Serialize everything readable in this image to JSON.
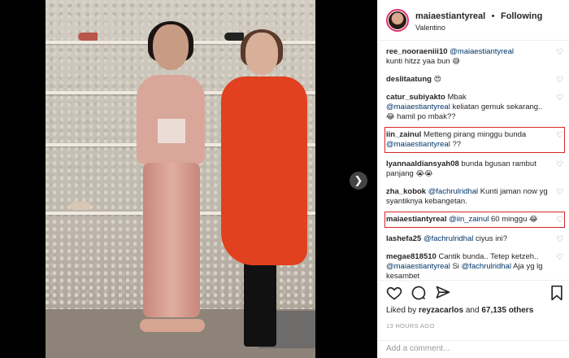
{
  "header": {
    "username": "maiaestiantyreal",
    "separator": "•",
    "follow_status": "Following",
    "location": "Valentino"
  },
  "comments": [
    {
      "user": "ree_nooraeniii10",
      "mention": "@maiaestiantyreal",
      "text": "kunti hitzz yaa bun",
      "emoji": "😅",
      "highlighted": false
    },
    {
      "user": "deslitaatung",
      "mention": "",
      "text": "",
      "emoji": "😍",
      "highlighted": false
    },
    {
      "user": "catur_subiyakto",
      "mention": "",
      "text": "Mbak",
      "mention2": "@maiaestiantyreal",
      "text2": "keliatan gemuk sekarang..",
      "emoji": "😂",
      "text3": "hamil po mbak??",
      "highlighted": false
    },
    {
      "user": "iin_zainul",
      "mention": "",
      "text": "Metteng pirang minggu bunda",
      "mention2": "@maiaestiantyreal",
      "text2": "??",
      "highlighted": true
    },
    {
      "user": "lyannaaldiansyah08",
      "mention": "",
      "text": "bunda bgusan rambut panjang",
      "emoji": "😭😭",
      "highlighted": false
    },
    {
      "user": "zha_kobok",
      "mention": "@fachrulridhal",
      "text": "Kunti jaman now yg syantiknya kebangetan.",
      "highlighted": false
    },
    {
      "user": "maiaestiantyreal",
      "mention": "@iin_zainul",
      "text": "60 minggu",
      "emoji": "😂",
      "highlighted": true
    },
    {
      "user": "lashefa25",
      "mention": "@fachrulridhal",
      "text": "ciyus ini?",
      "highlighted": false
    },
    {
      "user": "megae818510",
      "mention": "",
      "text": "Cantik bunda.. Tetep ketzeh..",
      "mention2": "@maiaestiantyreal",
      "text2": "Si",
      "mention3": "@fachrulridhal",
      "text3": "Aja yg lg kesambet",
      "highlighted": false
    }
  ],
  "likes": {
    "prefix": "Liked by",
    "user": "reyzacarlos",
    "middle": "and",
    "count": "67,135 others"
  },
  "timestamp": "13 HOURS AGO",
  "add_comment_placeholder": "Add a comment...",
  "icons": {
    "like": "heart-icon",
    "comment": "comment-icon",
    "share": "share-icon",
    "save": "bookmark-icon",
    "next": "chevron-right-icon"
  },
  "colors": {
    "highlight_box": "#d9252a",
    "mention": "#003569",
    "follow_ring": "#e1306c"
  }
}
